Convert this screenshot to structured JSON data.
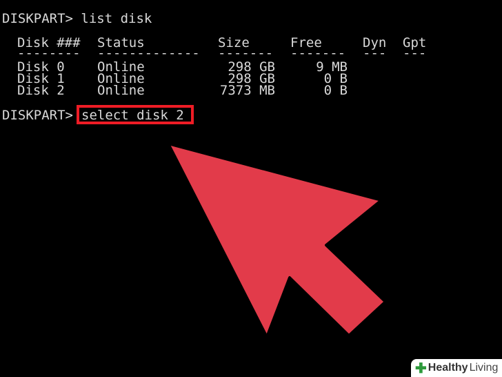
{
  "console": {
    "prompt_1": "DISKPART> list disk",
    "headers": {
      "disk": "Disk ###",
      "status": "Status",
      "size": "Size",
      "free": "Free",
      "dyn": "Dyn",
      "gpt": "Gpt"
    },
    "separators": {
      "disk": "--------",
      "status": "-------------",
      "size": "-------",
      "free": "-------",
      "dyn": "---",
      "gpt": "---"
    },
    "rows": [
      {
        "disk": "Disk 0",
        "status": "Online",
        "size": "298 GB",
        "free": "9 MB"
      },
      {
        "disk": "Disk 1",
        "status": "Online",
        "size": "298 GB",
        "free": "0 B"
      },
      {
        "disk": "Disk 2",
        "status": "Online",
        "size": "7373 MB",
        "free": "0 B"
      }
    ],
    "prompt_2_prefix": "DISKPART>",
    "prompt_2_command": "select disk 2"
  },
  "watermark": {
    "icon": "plus-icon",
    "word1": "Healthy",
    "word2": "Living"
  },
  "colors": {
    "background": "#000000",
    "text": "#d9d9d9",
    "highlight": "#ee1c25",
    "arrow": "#e23b4a"
  }
}
